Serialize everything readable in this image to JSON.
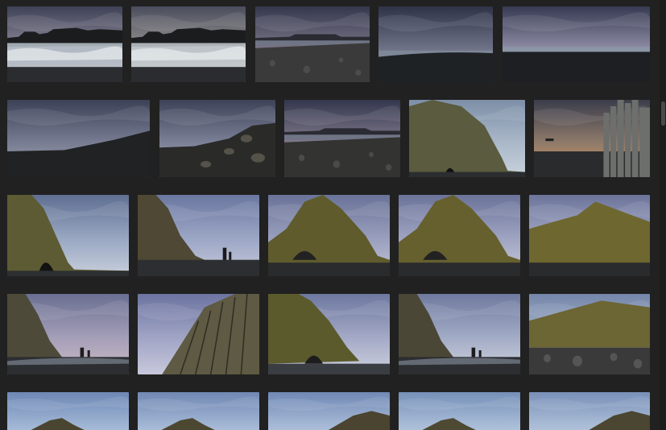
{
  "colors": {
    "background": "#212121",
    "thumbnail_placeholder": "#2b2b2b",
    "scrollbar_thumb": "#4a4a4a"
  },
  "rows": [
    {
      "items": [
        {
          "scene": "sea-stacks-waves",
          "sky": [
            "#3e4256",
            "#8b8697",
            "#c9b6b0"
          ],
          "ground": "#b9c2cb"
        },
        {
          "scene": "sea-stacks-waves",
          "sky": [
            "#4a4d5c",
            "#93908f",
            "#cfc0ae"
          ],
          "ground": "#c4ccd2"
        },
        {
          "scene": "rocky-shore-sunset",
          "sky": [
            "#34384d",
            "#7a7487",
            "#d6a79a"
          ],
          "ground": "#3b3a3a"
        },
        {
          "scene": "cloudy-beach",
          "sky": [
            "#2e3347",
            "#6e7186",
            "#b3a6ad"
          ],
          "ground": "#1f2224"
        },
        {
          "scene": "cloudy-horizon",
          "sky": [
            "#363a52",
            "#8d8aa3",
            "#c5b2b4"
          ],
          "ground": "#1d1f22"
        }
      ]
    },
    {
      "items": [
        {
          "scene": "dark-hill-clouds",
          "sky": [
            "#3b4157",
            "#777c92",
            "#a6a6b6"
          ],
          "ground": "#202224"
        },
        {
          "scene": "boulder-slope",
          "sky": [
            "#3d4258",
            "#7b8096",
            "#b0b2c0"
          ],
          "ground": "#2a2a29"
        },
        {
          "scene": "rocky-shore-sunset",
          "sky": [
            "#33374d",
            "#80788b",
            "#d1a89c"
          ],
          "ground": "#333331"
        },
        {
          "scene": "cliff-cave-right",
          "sky": [
            "#7d8fa7",
            "#a9b7c8",
            "#c9d3dd"
          ],
          "ground": "#5a5b3f"
        },
        {
          "scene": "basalt-columns",
          "sky": [
            "#3b3d4c",
            "#8e7a6a",
            "#d8985a"
          ],
          "ground": "#6d6f6d"
        }
      ]
    },
    {
      "items": [
        {
          "scene": "cliff-cave-left",
          "sky": [
            "#5f6f92",
            "#9aa8c3",
            "#c8cfdc"
          ],
          "ground": "#5d5b33"
        },
        {
          "scene": "cliff-stacks",
          "sky": [
            "#6a77a0",
            "#9da7c6",
            "#c6cadb"
          ],
          "ground": "#4e4834"
        },
        {
          "scene": "mossy-hill",
          "sky": [
            "#6a7398",
            "#9aa0be",
            "#c4c5d6"
          ],
          "ground": "#5f5b2d"
        },
        {
          "scene": "mossy-hill",
          "sky": [
            "#6b7399",
            "#a0a5c2",
            "#c9cad9"
          ],
          "ground": "#66602f"
        },
        {
          "scene": "mossy-ridge",
          "sky": [
            "#6c749a",
            "#a3a8c4",
            "#cfcfdc"
          ],
          "ground": "#6e6730"
        }
      ]
    },
    {
      "items": [
        {
          "scene": "cliff-beach-stacks",
          "sky": [
            "#6a6f92",
            "#a59fb8",
            "#cdbcc7"
          ],
          "ground": "#4d4a3a"
        },
        {
          "scene": "basalt-closeup",
          "sky": [
            "#6c74a0",
            "#a1a5c5",
            "#c8c8dc"
          ],
          "ground": "#5e5a43"
        },
        {
          "scene": "mossy-cliff-sea",
          "sky": [
            "#6e78a0",
            "#a4aac6",
            "#cfd1df"
          ],
          "ground": "#5b5a2c"
        },
        {
          "scene": "cliff-beach-stacks",
          "sky": [
            "#6f7a9f",
            "#a3acc6",
            "#d0d4df"
          ],
          "ground": "#4b4736"
        },
        {
          "scene": "mossy-ridge-rocks",
          "sky": [
            "#7486aa",
            "#a8b4ca",
            "#cfd6e0"
          ],
          "ground": "#6c6534"
        }
      ]
    },
    {
      "items": [
        {
          "scene": "hill-peak",
          "sky": [
            "#6e88b5",
            "#9cb2d2",
            "#c2d2e4"
          ],
          "ground": "#4a4530"
        },
        {
          "scene": "hill-peak",
          "sky": [
            "#7088b3",
            "#9fb3d2",
            "#c4d2e4"
          ],
          "ground": "#4c4731"
        },
        {
          "scene": "hill-right",
          "sky": [
            "#7089b5",
            "#a2b5d3",
            "#c5d3e5"
          ],
          "ground": "#4a4430"
        },
        {
          "scene": "hill-peak",
          "sky": [
            "#7590b8",
            "#a5b9d5",
            "#c7d6e6"
          ],
          "ground": "#4e4932"
        },
        {
          "scene": "hill-right",
          "sky": [
            "#7990b8",
            "#a7b9d4",
            "#c8d5e5"
          ],
          "ground": "#4b4631"
        }
      ]
    }
  ]
}
